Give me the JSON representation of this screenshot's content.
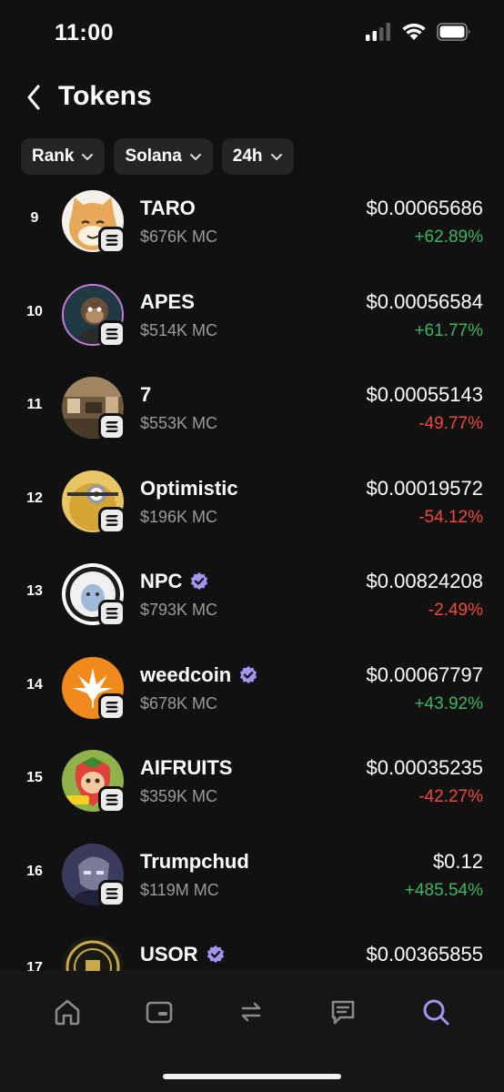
{
  "status": {
    "time": "11:00"
  },
  "header": {
    "title": "Tokens"
  },
  "filters": [
    {
      "label": "Rank"
    },
    {
      "label": "Solana"
    },
    {
      "label": "24h"
    }
  ],
  "tokens": [
    {
      "rank": "9",
      "name": "TARO",
      "verified": false,
      "mc": "$676K MC",
      "price": "$0.00065686",
      "change": "+62.89%",
      "direction": "up"
    },
    {
      "rank": "10",
      "name": "APES",
      "verified": false,
      "mc": "$514K MC",
      "price": "$0.00056584",
      "change": "+61.77%",
      "direction": "up"
    },
    {
      "rank": "11",
      "name": "7",
      "verified": false,
      "mc": "$553K MC",
      "price": "$0.00055143",
      "change": "-49.77%",
      "direction": "down"
    },
    {
      "rank": "12",
      "name": "Optimistic",
      "verified": false,
      "mc": "$196K MC",
      "price": "$0.00019572",
      "change": "-54.12%",
      "direction": "down"
    },
    {
      "rank": "13",
      "name": "NPC",
      "verified": true,
      "mc": "$793K MC",
      "price": "$0.00824208",
      "change": "-2.49%",
      "direction": "down"
    },
    {
      "rank": "14",
      "name": "weedcoin",
      "verified": true,
      "mc": "$678K MC",
      "price": "$0.00067797",
      "change": "+43.92%",
      "direction": "up"
    },
    {
      "rank": "15",
      "name": "AIFRUITS",
      "verified": false,
      "mc": "$359K MC",
      "price": "$0.00035235",
      "change": "-42.27%",
      "direction": "down"
    },
    {
      "rank": "16",
      "name": "Trumpchud",
      "verified": false,
      "mc": "$119M MC",
      "price": "$0.12",
      "change": "+485.54%",
      "direction": "up"
    },
    {
      "rank": "17",
      "name": "USOR",
      "verified": true,
      "mc": "",
      "price": "$0.00365855",
      "change": "",
      "direction": "up"
    }
  ],
  "colors": {
    "background": "#111111",
    "positive": "#3fb55f",
    "negative": "#ef4a3b",
    "accent": "#a394f0",
    "muted": "#9a9a9a"
  },
  "tabbar": {
    "items": [
      {
        "icon": "home-icon",
        "active": false
      },
      {
        "icon": "wallet-icon",
        "active": false
      },
      {
        "icon": "swap-icon",
        "active": false
      },
      {
        "icon": "chat-icon",
        "active": false
      },
      {
        "icon": "search-icon",
        "active": true
      }
    ]
  }
}
